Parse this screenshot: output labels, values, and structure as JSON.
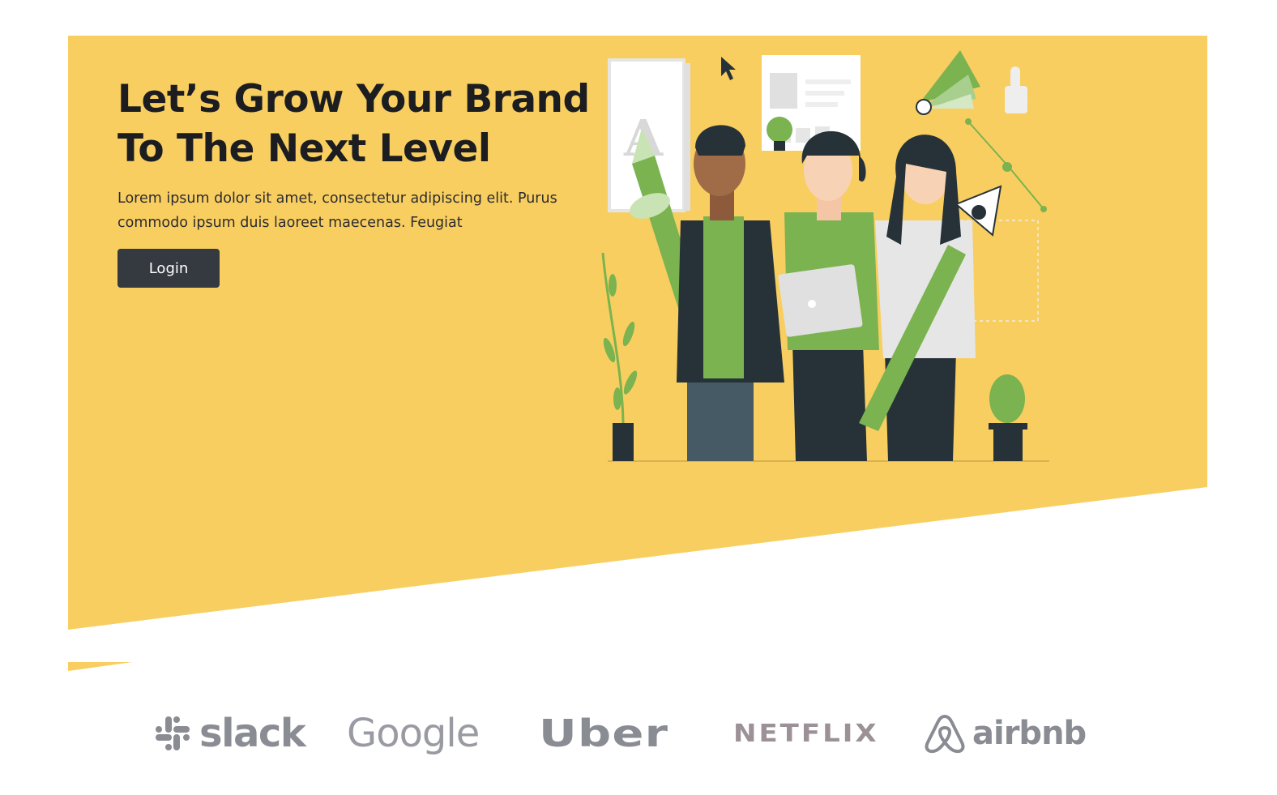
{
  "colors": {
    "hero_background": "#f9ce60",
    "headline_text": "#1c1d21",
    "button_background": "#343a40",
    "button_text": "#ffffff",
    "logo_gray": "#8a8c93",
    "illustration_green": "#7ab34f",
    "illustration_dark": "#263238"
  },
  "hero": {
    "headline_line1": "Let’s Grow Your Brand",
    "headline_line2": "To The Next Level",
    "description": "Lorem ipsum dolor sit amet, consectetur adipiscing elit. Purus commodo ipsum duis laoreet maecenas. Feugiat",
    "login_label": "Login",
    "illustration": "team-creative-illustration"
  },
  "brand_logos": {
    "items": [
      {
        "name": "slack",
        "label": "slack",
        "icon": "slack-hash-icon"
      },
      {
        "name": "google",
        "label": "Google",
        "icon": ""
      },
      {
        "name": "uber",
        "label": "Uber",
        "icon": ""
      },
      {
        "name": "netflix",
        "label": "NETFLIX",
        "icon": ""
      },
      {
        "name": "airbnb",
        "label": "airbnb",
        "icon": "airbnb-belo-icon"
      }
    ]
  }
}
